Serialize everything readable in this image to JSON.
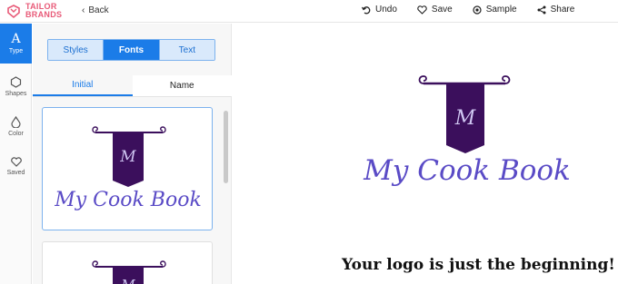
{
  "brand": {
    "line1": "TAILOR",
    "line2": "BRANDS",
    "color": "#e85a78"
  },
  "nav": {
    "back_label": "Back"
  },
  "actions": [
    {
      "icon": "undo-icon",
      "label": "Undo"
    },
    {
      "icon": "heart-icon",
      "label": "Save"
    },
    {
      "icon": "sample-icon",
      "label": "Sample"
    },
    {
      "icon": "share-icon",
      "label": "Share"
    }
  ],
  "sidebar": {
    "items": [
      {
        "icon": "A",
        "label": "Type",
        "active": true
      },
      {
        "icon": "shapes-icon",
        "label": "Shapes"
      },
      {
        "icon": "droplet-icon",
        "label": "Color"
      },
      {
        "icon": "heart-icon",
        "label": "Saved"
      }
    ]
  },
  "panel": {
    "segments": [
      "Styles",
      "Fonts",
      "Text"
    ],
    "active_segment": "Fonts",
    "subtabs": [
      "Initial",
      "Name"
    ],
    "active_subtab": "Initial"
  },
  "logo": {
    "initial": "M",
    "name": "My Cook Book",
    "banner_color": "#3b0f5c",
    "text_color": "#5a4bc6"
  },
  "canvas": {
    "tagline": "Your logo is just the beginning!"
  },
  "accent": "#1b7ce8"
}
